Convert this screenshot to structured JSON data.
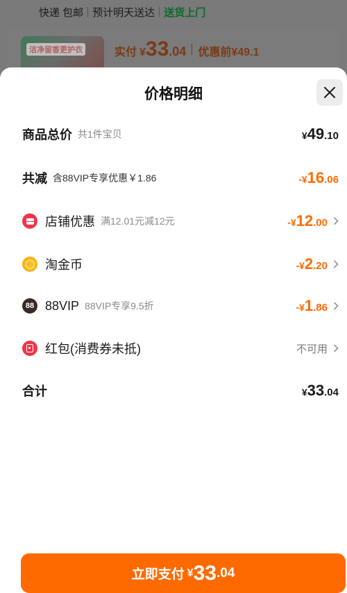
{
  "background": {
    "shipping": {
      "method": "快递 包邮",
      "eta": "预计明天送达",
      "door": "送货上门"
    },
    "product_thumb_text": "洁净留香更护衣",
    "price": {
      "paid_label": "实付",
      "yen": "¥",
      "paid_int": "33",
      "paid_dec": ".04",
      "before_label": "优惠前",
      "before_value": "¥49.1"
    }
  },
  "sheet": {
    "title": "价格明细",
    "rows": [
      {
        "name": "商品总价",
        "sub": "共1件宝贝",
        "yen": "¥",
        "int": "49",
        "dec": ".10"
      },
      {
        "name": "共减",
        "sub": "含88VIP专享优惠￥1.86",
        "yen": "-¥",
        "int": "16",
        "dec": ".06"
      },
      {
        "name": "店铺优惠",
        "sub": "满12.01元减12元",
        "yen": "-¥",
        "int": "12",
        "dec": ".00",
        "icon": "shop-coupon-icon"
      },
      {
        "name": "淘金币",
        "sub": "",
        "yen": "-¥",
        "int": "2",
        "dec": ".20",
        "icon": "gold-coin-icon"
      },
      {
        "name": "88VIP",
        "sub": "88VIP专享9.5折",
        "yen": "-¥",
        "int": "1",
        "dec": ".86",
        "icon": "vip-88-icon",
        "icon_text": "88"
      },
      {
        "name": "红包(消费券未抵)",
        "sub": "",
        "status": "不可用",
        "icon": "red-packet-icon"
      },
      {
        "name": "合计",
        "sub": "",
        "yen": "¥",
        "int": "33",
        "dec": ".04"
      }
    ],
    "pay_button": {
      "label": "立即支付",
      "yen": "¥",
      "int": "33",
      "dec": ".04"
    }
  },
  "colors": {
    "accent": "#ff6a00",
    "discount_text": "#ff6a00",
    "coupon_red": "#f0344a",
    "coin_gold": "#f7b21b"
  }
}
